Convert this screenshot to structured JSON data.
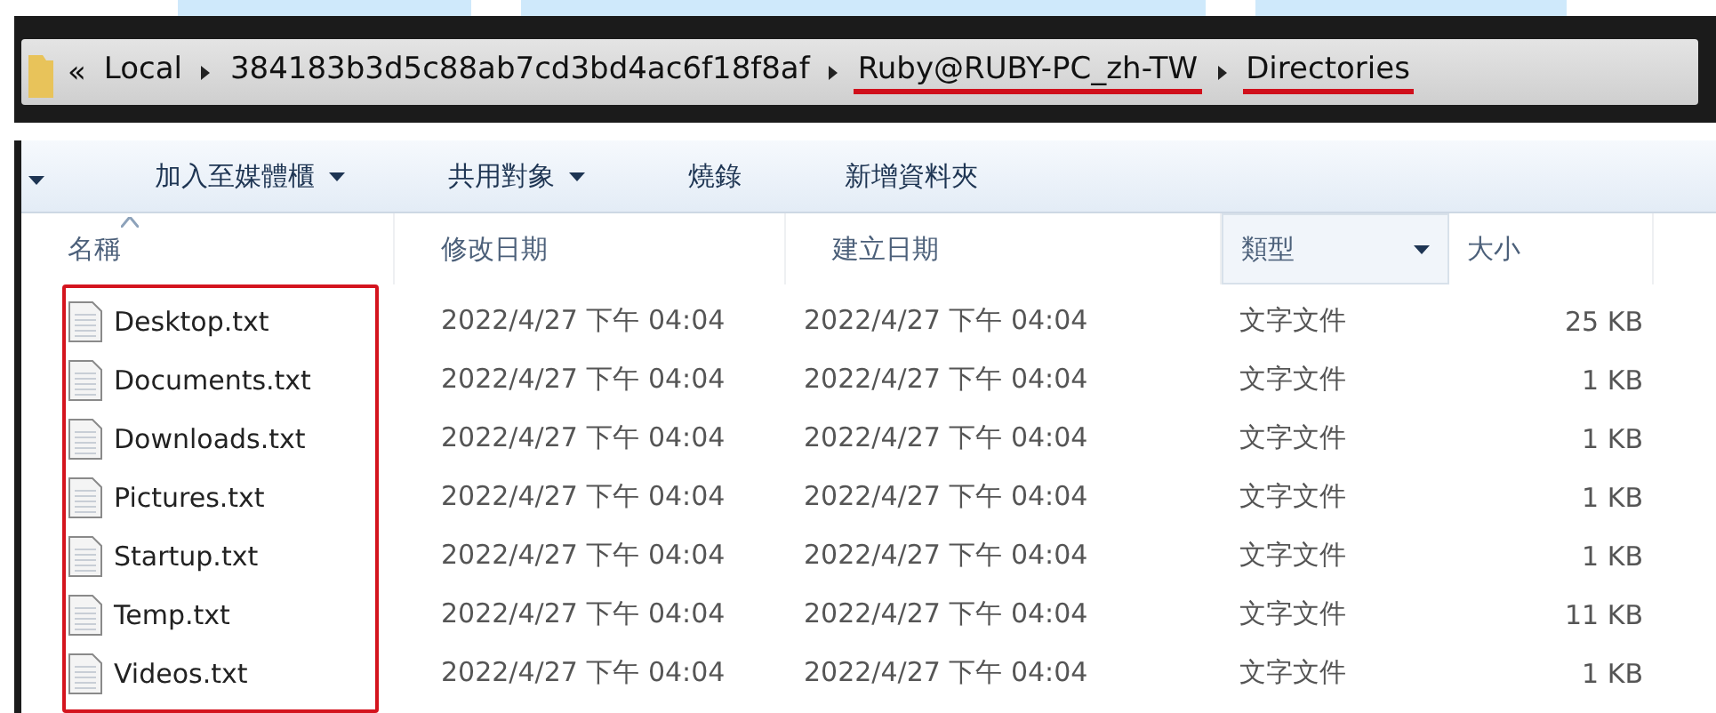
{
  "address_bar": {
    "overflow": "«",
    "crumbs": [
      {
        "label": "Local",
        "marked": false
      },
      {
        "label": "384183b3d5c88ab7cd3bd4ac6f18f8af",
        "marked": false
      },
      {
        "label": "Ruby@RUBY-PC_zh-TW",
        "marked": true
      },
      {
        "label": "Directories",
        "marked": true
      }
    ]
  },
  "toolbar": {
    "items": [
      {
        "label": "加入至媒體櫃",
        "dropdown": true
      },
      {
        "label": "共用對象",
        "dropdown": true
      },
      {
        "label": "燒錄",
        "dropdown": false
      },
      {
        "label": "新增資料夾",
        "dropdown": false
      }
    ]
  },
  "table": {
    "columns": [
      {
        "label": "名稱",
        "sorted": true,
        "selected": false
      },
      {
        "label": "修改日期",
        "sorted": false,
        "selected": false
      },
      {
        "label": "建立日期",
        "sorted": false,
        "selected": false
      },
      {
        "label": "類型",
        "sorted": false,
        "selected": true
      },
      {
        "label": "大小",
        "sorted": false,
        "selected": false
      }
    ],
    "rows": [
      {
        "name": "Desktop.txt",
        "modified": "2022/4/27 下午 04:04",
        "created": "2022/4/27 下午 04:04",
        "type": "文字文件",
        "size": "25 KB"
      },
      {
        "name": "Documents.txt",
        "modified": "2022/4/27 下午 04:04",
        "created": "2022/4/27 下午 04:04",
        "type": "文字文件",
        "size": "1 KB"
      },
      {
        "name": "Downloads.txt",
        "modified": "2022/4/27 下午 04:04",
        "created": "2022/4/27 下午 04:04",
        "type": "文字文件",
        "size": "1 KB"
      },
      {
        "name": "Pictures.txt",
        "modified": "2022/4/27 下午 04:04",
        "created": "2022/4/27 下午 04:04",
        "type": "文字文件",
        "size": "1 KB"
      },
      {
        "name": "Startup.txt",
        "modified": "2022/4/27 下午 04:04",
        "created": "2022/4/27 下午 04:04",
        "type": "文字文件",
        "size": "1 KB"
      },
      {
        "name": "Temp.txt",
        "modified": "2022/4/27 下午 04:04",
        "created": "2022/4/27 下午 04:04",
        "type": "文字文件",
        "size": "11 KB"
      },
      {
        "name": "Videos.txt",
        "modified": "2022/4/27 下午 04:04",
        "created": "2022/4/27 下午 04:04",
        "type": "文字文件",
        "size": "1 KB"
      }
    ],
    "names_highlighted": true
  }
}
